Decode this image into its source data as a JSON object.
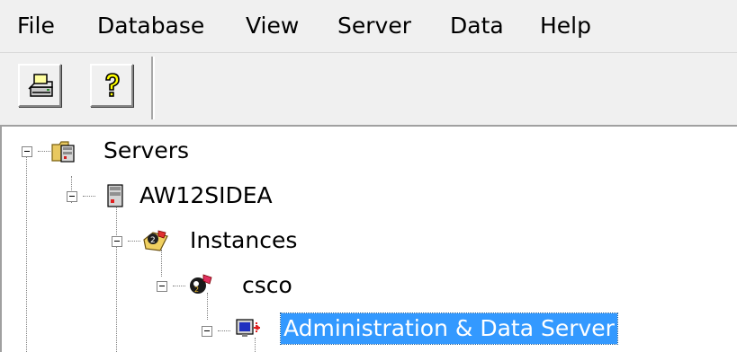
{
  "menubar": {
    "items": [
      {
        "label": "File"
      },
      {
        "label": "Database"
      },
      {
        "label": "View"
      },
      {
        "label": "Server"
      },
      {
        "label": "Data"
      },
      {
        "label": "Help"
      }
    ]
  },
  "toolbar": {
    "buttons": [
      {
        "icon": "print-icon"
      },
      {
        "icon": "help-question-icon"
      }
    ]
  },
  "tree": {
    "selection_color": "#3399ff",
    "nodes": [
      {
        "label": "Servers",
        "icon": "servers-folder-icon",
        "expanded": true
      },
      {
        "label": "AW12SIDEA",
        "icon": "server-icon",
        "expanded": true
      },
      {
        "label": "Instances",
        "icon": "instances-icon",
        "expanded": true
      },
      {
        "label": "csco",
        "icon": "instance-icon",
        "expanded": true
      },
      {
        "label": "Administration & Data Server",
        "icon": "admin-data-server-icon",
        "expanded": true,
        "selected": true
      }
    ]
  }
}
